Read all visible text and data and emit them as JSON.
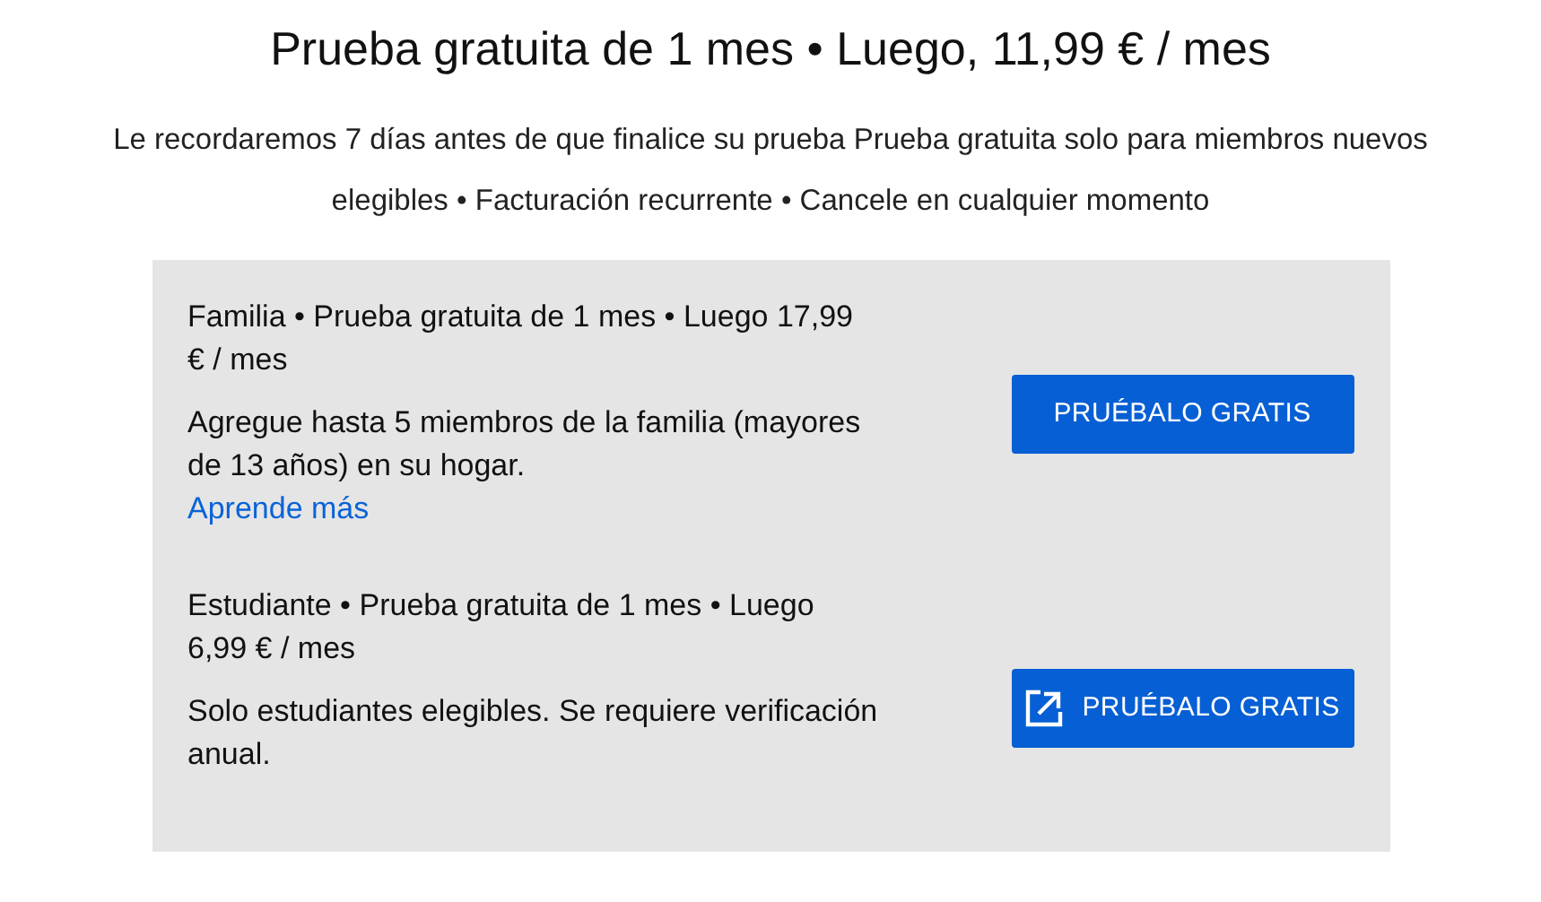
{
  "heading": "Prueba gratuita de 1 mes • Luego, 11,99 € / mes",
  "subheading": "Le recordaremos 7 días antes de que finalice su prueba Prueba gratuita solo para miembros nuevos elegibles • Facturación recurrente • Cancele en cualquier momento",
  "plans": [
    {
      "title": "Familia • Prueba gratuita de 1 mes • Luego 17,99 € / mes",
      "description": "Agregue hasta 5 miembros de la familia (mayores de 13 años) en su hogar.",
      "link": "Aprende más",
      "button": {
        "label": "PRUÉBALO GRATIS",
        "kind": "plain"
      }
    },
    {
      "title": "Estudiante • Prueba gratuita de 1 mes • Luego 6,99 € / mes",
      "description": "Solo estudiantes elegibles. Se requiere verificación anual.",
      "button": {
        "label": "PRUÉBALO GRATIS",
        "kind": "external"
      }
    }
  ]
}
